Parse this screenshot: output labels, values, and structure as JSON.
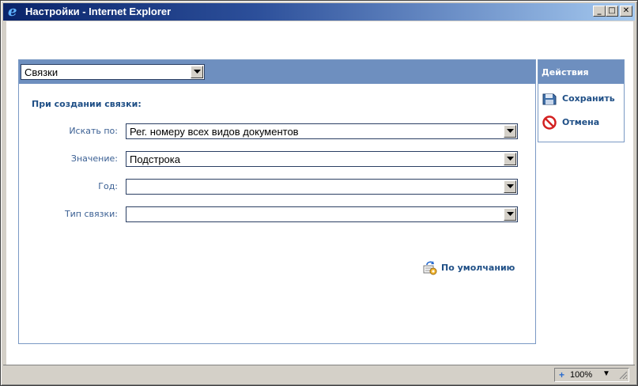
{
  "window": {
    "title": "Настройки - Internet Explorer"
  },
  "window_controls": {
    "minimize": "_",
    "maximize": "□",
    "close": "✕"
  },
  "header": {
    "category_select": "Связки"
  },
  "form": {
    "section_title": "При создании связки:",
    "fields": [
      {
        "label": "Искать по:",
        "value": "Рег. номеру всех видов документов"
      },
      {
        "label": "Значение:",
        "value": "Подстрока"
      },
      {
        "label": "Год:",
        "value": ""
      },
      {
        "label": "Тип связки:",
        "value": ""
      }
    ],
    "default_link": "По умолчанию"
  },
  "actions": {
    "title": "Действия",
    "save": "Сохранить",
    "cancel": "Отмена"
  },
  "status": {
    "zoom": "100%"
  },
  "icons": {
    "title": "ie-logo-icon",
    "save": "floppy-disk-icon",
    "cancel": "no-entry-icon",
    "default": "reset-settings-icon",
    "dropdown": "chevron-down-icon",
    "zoom": "magnifier-plus-icon"
  },
  "colors": {
    "panel_header": "#6e8fbf",
    "link_text": "#1f4f86",
    "label_text": "#3a5f93",
    "cancel_red": "#d32020"
  }
}
